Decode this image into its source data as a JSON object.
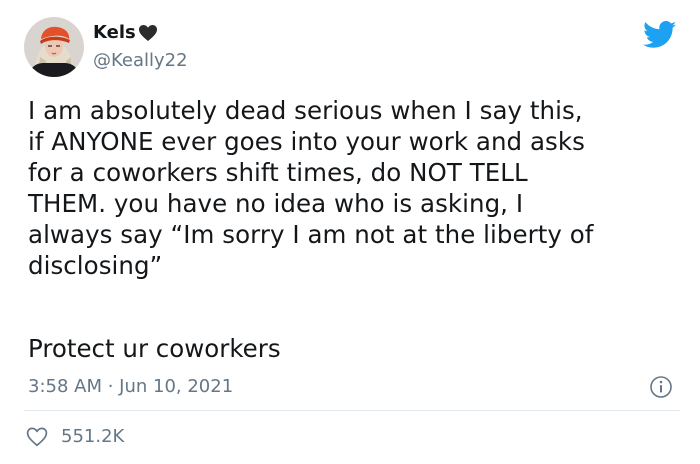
{
  "author": {
    "display_name": "Kels",
    "handle": "@Keally22",
    "name_emoji_icon": "black-heart-icon",
    "avatar_icon": "user-avatar"
  },
  "platform_icon": "twitter-bird-icon",
  "tweet": {
    "text": "I am absolutely dead serious when I say this,\nif ANYONE ever goes into your work and asks\nfor a coworkers shift times, do NOT TELL\nTHEM. you have no idea who is asking, I\nalways say “Im sorry I am not at the liberty of\ndisclosing”",
    "text_2": "Protect ur coworkers",
    "timestamp": "3:58 AM · Jun 10, 2021",
    "likes": "551.2K"
  },
  "colors": {
    "twitter_blue": "#1da1f2",
    "secondary_text": "#657786",
    "divider": "#e1e8ed",
    "primary_text": "#14171a"
  }
}
